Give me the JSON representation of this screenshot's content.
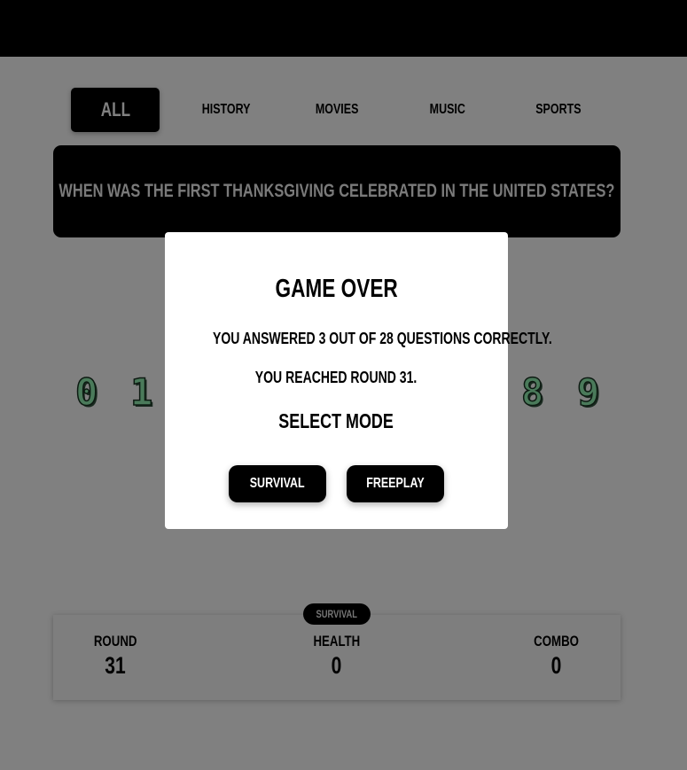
{
  "tabs": [
    {
      "label": "All",
      "active": true
    },
    {
      "label": "History"
    },
    {
      "label": "Movies"
    },
    {
      "label": "Music"
    },
    {
      "label": "Sports"
    }
  ],
  "question": "When was the first Thanksgiving celebrated in the United States?",
  "visible_digits": [
    "0",
    "1",
    "8",
    "9"
  ],
  "mode_badge": "Survival",
  "stats": {
    "round": {
      "label": "Round",
      "value": "31"
    },
    "health": {
      "label": "Health",
      "value": "0"
    },
    "combo": {
      "label": "Combo",
      "value": "0"
    }
  },
  "modal": {
    "title": "Game Over",
    "summary": "You answered 3 out of 28 questions correctly.",
    "round_text": "You reached round 31.",
    "select_mode": "Select Mode",
    "buttons": {
      "survival": "Survival",
      "freeplay": "Freeplay"
    }
  },
  "colors": {
    "overlay": "#808080",
    "digit": "#4a7a5a"
  }
}
